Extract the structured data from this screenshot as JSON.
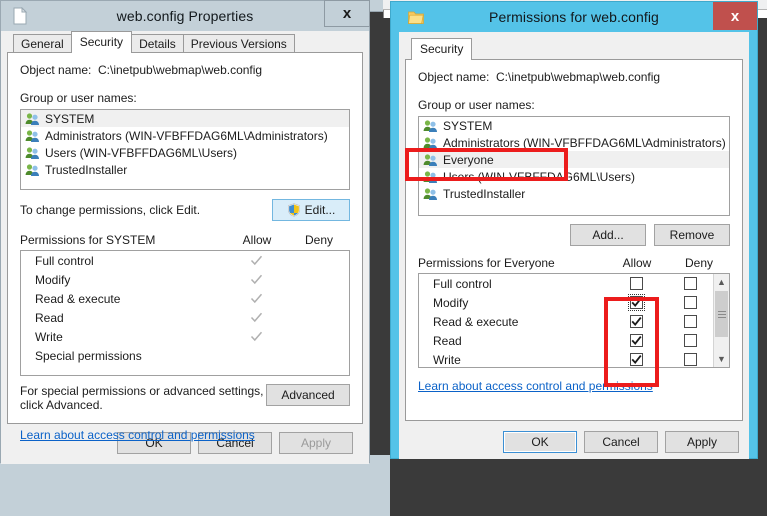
{
  "desktop": {
    "background_color": "#3a3a3a"
  },
  "properties_dialog": {
    "title": "web.config Properties",
    "title_icon": "file-icon",
    "close_label": "x",
    "active": false,
    "tabs": [
      {
        "label": "General",
        "active": false
      },
      {
        "label": "Security",
        "active": true
      },
      {
        "label": "Details",
        "active": false
      },
      {
        "label": "Previous Versions",
        "active": false
      }
    ],
    "object_name_label": "Object name:",
    "object_name_value": "C:\\inetpub\\webmap\\web.config",
    "group_label": "Group or user names:",
    "group_items": [
      {
        "name": "SYSTEM",
        "selected": true
      },
      {
        "name": "Administrators (WIN-VFBFFDAG6ML\\Administrators)",
        "selected": false
      },
      {
        "name": "Users (WIN-VFBFFDAG6ML\\Users)",
        "selected": false
      },
      {
        "name": "TrustedInstaller",
        "selected": false
      }
    ],
    "edit_hint": "To change permissions, click Edit.",
    "edit_button": "Edit...",
    "permissions_label": "Permissions for SYSTEM",
    "allow_header": "Allow",
    "deny_header": "Deny",
    "permissions": [
      {
        "name": "Full control",
        "allow": "check-grey",
        "deny": ""
      },
      {
        "name": "Modify",
        "allow": "check-grey",
        "deny": ""
      },
      {
        "name": "Read & execute",
        "allow": "check-grey",
        "deny": ""
      },
      {
        "name": "Read",
        "allow": "check-grey",
        "deny": ""
      },
      {
        "name": "Write",
        "allow": "check-grey",
        "deny": ""
      },
      {
        "name": "Special permissions",
        "allow": "",
        "deny": ""
      }
    ],
    "advanced_hint_line1": "For special permissions or advanced settings,",
    "advanced_hint_line2": "click Advanced.",
    "advanced_button": "Advanced",
    "learn_link": "Learn about access control and permissions",
    "ok_button": "OK",
    "cancel_button": "Cancel",
    "apply_button": "Apply",
    "apply_disabled": true
  },
  "permissions_dialog": {
    "title": "Permissions for web.config",
    "title_icon": "folder-icon",
    "close_label": "x",
    "active": true,
    "accent_color": "#54c3e8",
    "close_color": "#c0504d",
    "tabs": [
      {
        "label": "Security",
        "active": true
      }
    ],
    "object_name_label": "Object name:",
    "object_name_value": "C:\\inetpub\\webmap\\web.config",
    "group_label": "Group or user names:",
    "group_items": [
      {
        "name": "SYSTEM",
        "selected": false
      },
      {
        "name": "Administrators (WIN-VFBFFDAG6ML\\Administrators)",
        "selected": false
      },
      {
        "name": "Everyone",
        "selected": true
      },
      {
        "name": "Users (WIN-VFBFFDAG6ML\\Users)",
        "selected": false
      },
      {
        "name": "TrustedInstaller",
        "selected": false
      }
    ],
    "add_button": "Add...",
    "remove_button": "Remove",
    "permissions_label": "Permissions for Everyone",
    "allow_header": "Allow",
    "deny_header": "Deny",
    "permissions": [
      {
        "name": "Full control",
        "allow": "unchecked",
        "deny": "unchecked",
        "focused": false
      },
      {
        "name": "Modify",
        "allow": "checked",
        "deny": "unchecked",
        "focused": true
      },
      {
        "name": "Read & execute",
        "allow": "checked",
        "deny": "unchecked",
        "focused": false
      },
      {
        "name": "Read",
        "allow": "checked",
        "deny": "unchecked",
        "focused": false
      },
      {
        "name": "Write",
        "allow": "checked",
        "deny": "unchecked",
        "focused": false
      }
    ],
    "learn_link": "Learn about access control and permissions",
    "ok_button": "OK",
    "cancel_button": "Cancel",
    "apply_button": "Apply",
    "apply_disabled": false
  },
  "annotations": {
    "color": "#ec1c1c",
    "boxes": [
      {
        "name": "everyone-highlight"
      },
      {
        "name": "allow-column-highlight"
      }
    ]
  }
}
